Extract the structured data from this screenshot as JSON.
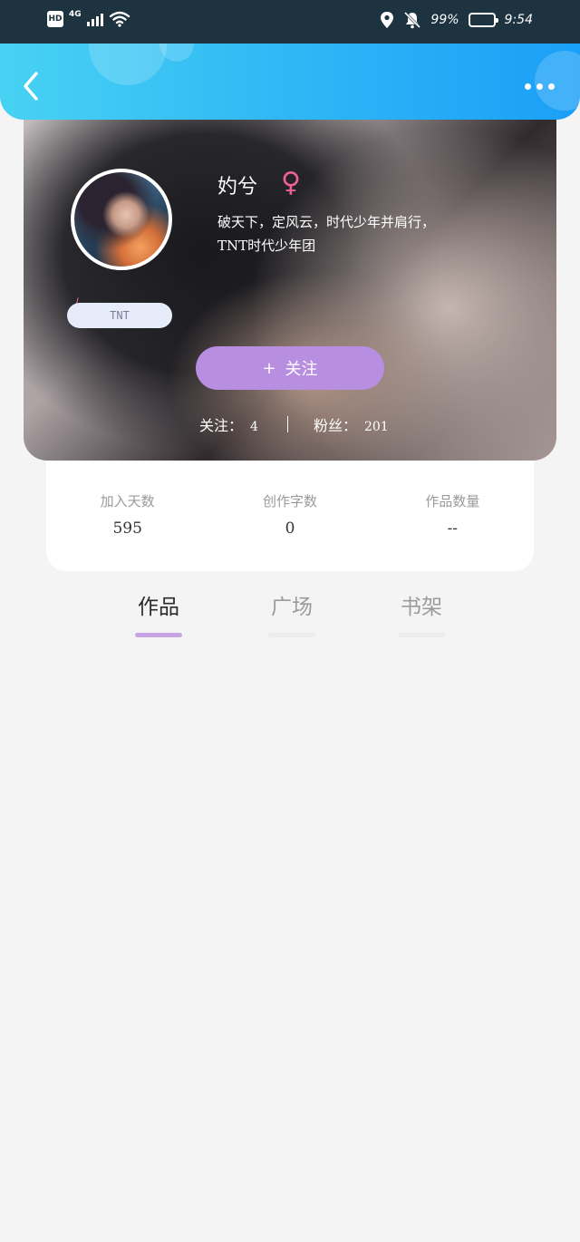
{
  "status_bar": {
    "hd_badge": "HD",
    "network": "4G",
    "battery_percent": "99%",
    "time": "9:54",
    "icons": [
      "signal-icon",
      "wifi-icon",
      "location-icon",
      "bell-muted-icon",
      "battery-icon"
    ]
  },
  "header": {
    "back_icon": "chevron-left-icon",
    "more_icon": "more-dots-icon"
  },
  "profile": {
    "username": "妁兮",
    "gender_symbol": "♀",
    "bio_line1": "破天下，定风云，时代少年并肩行，",
    "bio_line2": "TNT时代少年团",
    "tag": "TNT",
    "follow_label": "关注",
    "follow_plus": "+",
    "following_label": "关注：",
    "following_count": "4",
    "fans_label": "粉丝：",
    "fans_count": "201"
  },
  "stats": [
    {
      "label": "加入天数",
      "value": "595"
    },
    {
      "label": "创作字数",
      "value": "0"
    },
    {
      "label": "作品数量",
      "value": "--"
    }
  ],
  "tabs": [
    {
      "label": "作品",
      "active": true
    },
    {
      "label": "广场",
      "active": false
    },
    {
      "label": "书架",
      "active": false
    }
  ],
  "colors": {
    "header_gradient_start": "#47d2f3",
    "header_gradient_end": "#1a9ff7",
    "follow_button": "#b88ee0",
    "active_tab_underline": "#c6a4e6",
    "gender_icon": "#f06292"
  }
}
